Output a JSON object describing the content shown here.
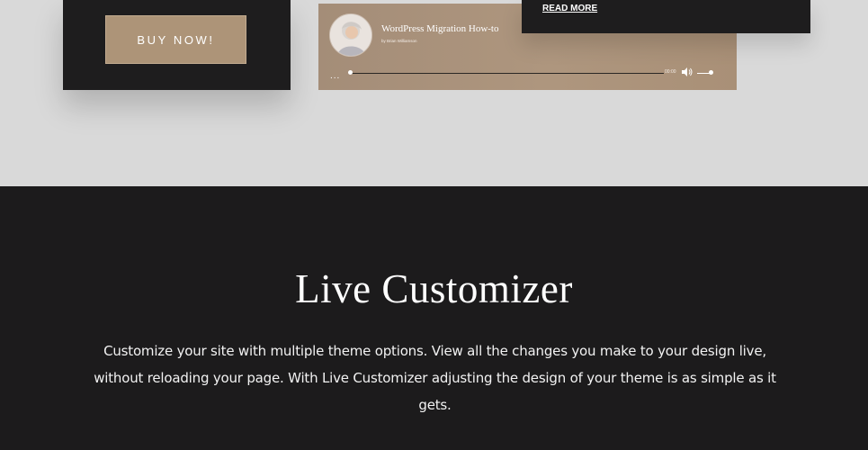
{
  "buy_card": {
    "button_label": "BUY NOW!"
  },
  "player": {
    "title": "WordPress Migration How-to",
    "author": "by Brian Williamson",
    "more": "...",
    "time": "00:00",
    "progress": 0,
    "volume": 0.8,
    "icons": [
      "avatar",
      "volume-icon"
    ]
  },
  "post_card": {
    "read_more": "READ MORE"
  },
  "section": {
    "title": "Live Customizer",
    "description": "Customize your site with multiple theme options. View all the changes you make to your design live, without reloading your page. With Live Customizer adjusting the design of your theme is as simple as it gets."
  },
  "colors": {
    "accent": "#ad9478",
    "dark": "#1c1b1c",
    "light_bg": "#d9d9d9"
  }
}
